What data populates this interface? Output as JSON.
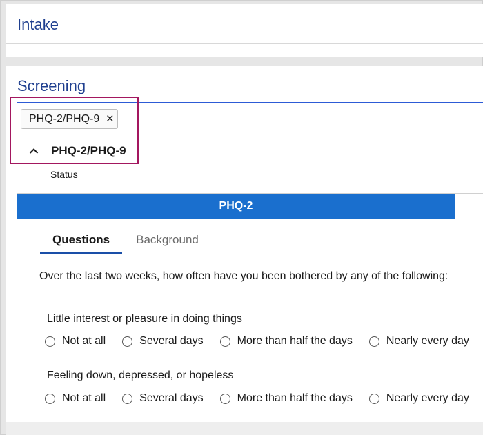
{
  "intake": {
    "title": "Intake"
  },
  "screening": {
    "title": "Screening",
    "selected_chip": "PHQ-2/PHQ-9",
    "chip_remove": "×",
    "section_title": "PHQ-2/PHQ-9",
    "status_label": "Status"
  },
  "progress": {
    "label": "PHQ-2",
    "fraction": 0.93,
    "color": "#1a6fce"
  },
  "tabs": [
    {
      "label": "Questions",
      "active": true
    },
    {
      "label": "Background",
      "active": false
    }
  ],
  "prompt": "Over the last two weeks, how often have you been bothered by any of the following:",
  "questions": [
    {
      "label": "Little interest or pleasure in doing things",
      "options": [
        "Not at all",
        "Several days",
        "More than half the days",
        "Nearly every day"
      ]
    },
    {
      "label": "Feeling down, depressed, or hopeless",
      "options": [
        "Not at all",
        "Several days",
        "More than half the days",
        "Nearly every day"
      ]
    }
  ],
  "colors": {
    "accent": "#1f3f8f",
    "highlight_border": "#a3175f"
  },
  "icons": {
    "chevron": "chevron-up-icon",
    "remove": "close-icon"
  }
}
